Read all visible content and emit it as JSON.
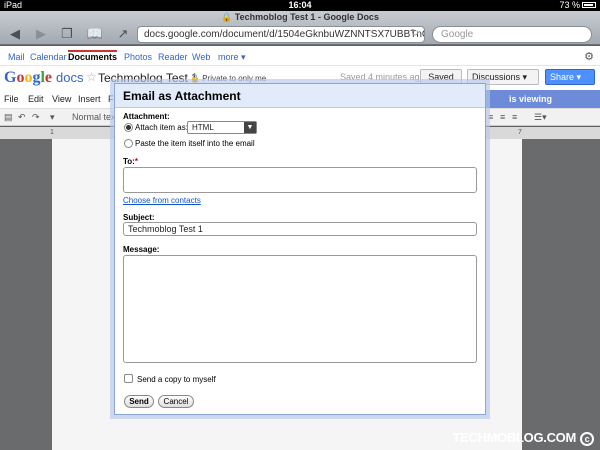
{
  "status_bar": {
    "device": "iPad",
    "time": "16:04",
    "battery": "73 %"
  },
  "browser": {
    "page_title": "Techmoblog Test 1 - Google Docs",
    "url": "docs.google.com/document/d/1504eGknbuWZNNTSX7UBBTnGOj...",
    "search_placeholder": "Google"
  },
  "google_bar": {
    "items": [
      "Mail",
      "Calendar",
      "Documents",
      "Photos",
      "Reader",
      "Web",
      "more ▾"
    ],
    "active": "Documents"
  },
  "doc_header": {
    "logo_google": [
      "G",
      "o",
      "o",
      "g",
      "l",
      "e"
    ],
    "logo_docs": "docs",
    "title": "Techmoblog Test 1",
    "privacy": "Private to only me",
    "saved_status": "Saved 4 minutes ago",
    "save_label": "Saved",
    "discussions_label": "Discussions ▾",
    "share_label": "Share ▾"
  },
  "menu": {
    "items": [
      "File",
      "Edit",
      "View",
      "Insert",
      "F"
    ],
    "viewing": "is viewing"
  },
  "format_bar": {
    "font": "Normal text"
  },
  "ruler": {
    "start": "1",
    "end": "7"
  },
  "dialog": {
    "title": "Email as Attachment",
    "attachment_label": "Attachment:",
    "attach_as_label": "Attach item as:",
    "attach_format": "HTML",
    "paste_label": "Paste the item itself into the email",
    "to_label": "To:",
    "required_mark": "*",
    "to_value": "",
    "choose_contacts": "Choose from contacts",
    "subject_label": "Subject:",
    "subject_value": "Techmoblog Test 1",
    "message_label": "Message:",
    "message_value": "",
    "copy_label": "Send a copy to myself",
    "send_label": "Send",
    "cancel_label": "Cancel"
  },
  "watermark": {
    "text1": "TECHMO",
    "text2": "BLOG.COM",
    "symbol": "c"
  }
}
